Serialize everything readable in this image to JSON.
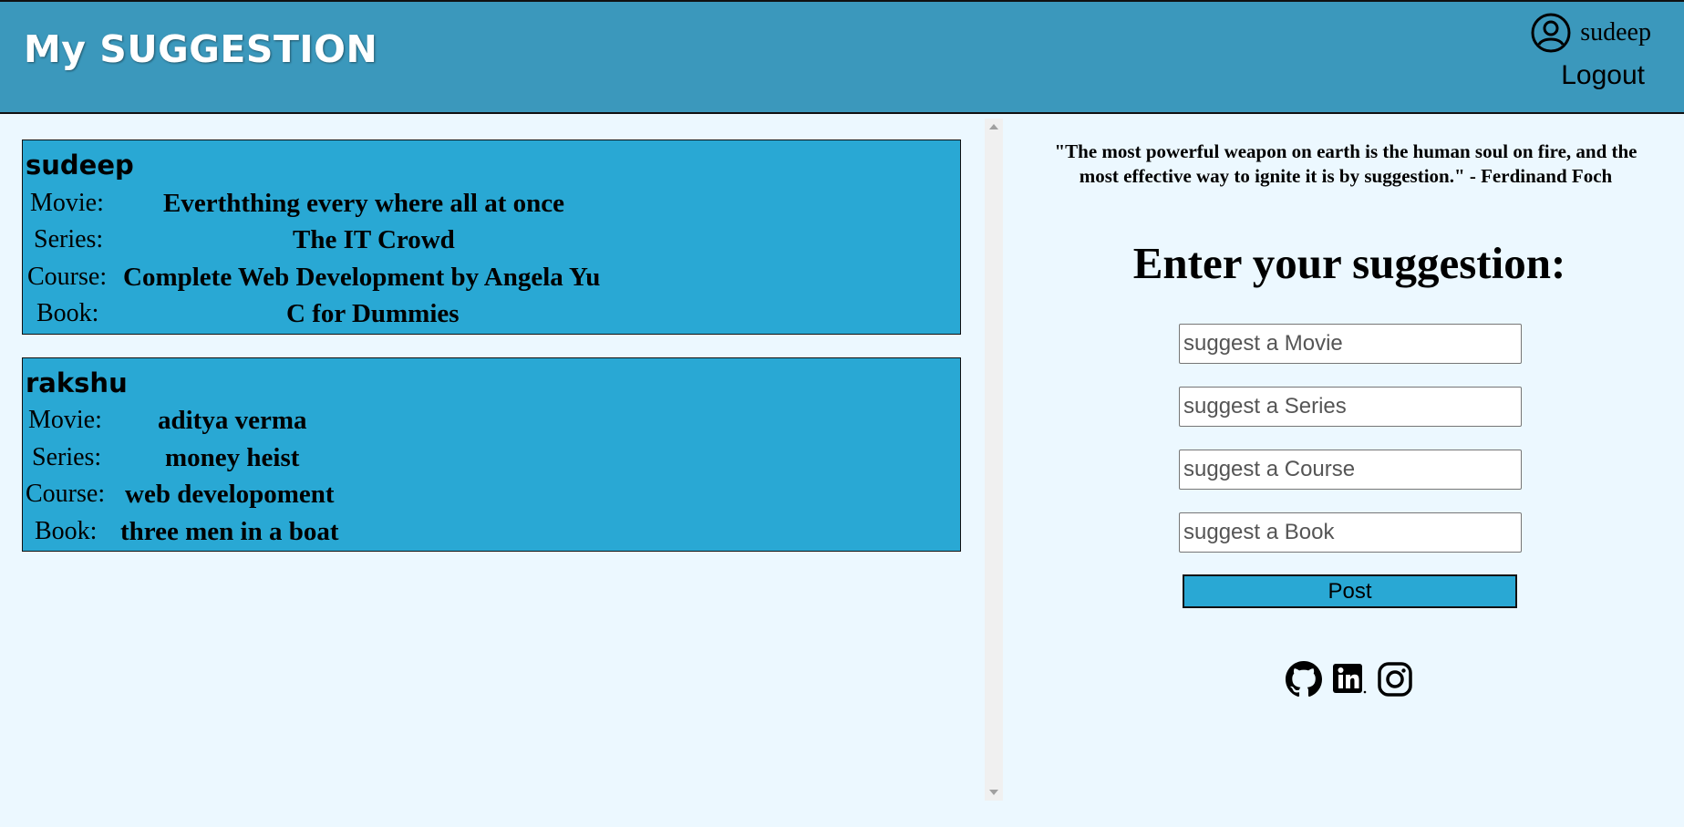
{
  "header": {
    "title": "My SUGGESTION",
    "username": "sudeep",
    "logout_label": "Logout"
  },
  "feed": {
    "labels": {
      "movie": "Movie:",
      "series": "Series:",
      "course": "Course:",
      "book": "Book:"
    },
    "cards": [
      {
        "user": "sudeep",
        "movie": "Everththing every where all at once",
        "series": "The IT Crowd",
        "course": "Complete Web Development by Angela Yu",
        "book": "C for Dummies"
      },
      {
        "user": "rakshu",
        "movie": "aditya verma",
        "series": "money heist",
        "course": "web developoment",
        "book": "three men in a boat"
      }
    ]
  },
  "form": {
    "quote": "\"The most powerful weapon on earth is the human soul on fire, and the most effective way to ignite it is by suggestion.\" - Ferdinand Foch",
    "heading": "Enter your suggestion:",
    "movie_placeholder": "suggest a Movie",
    "series_placeholder": "suggest a Series",
    "course_placeholder": "suggest a Course",
    "book_placeholder": "suggest a Book",
    "post_label": "Post"
  },
  "social": {
    "icons": [
      "github-icon",
      "linkedin-icon",
      "instagram-icon"
    ]
  },
  "colors": {
    "header_bg": "#3b98bc",
    "card_bg": "#29a8d4",
    "page_bg": "#ecf8ff"
  }
}
